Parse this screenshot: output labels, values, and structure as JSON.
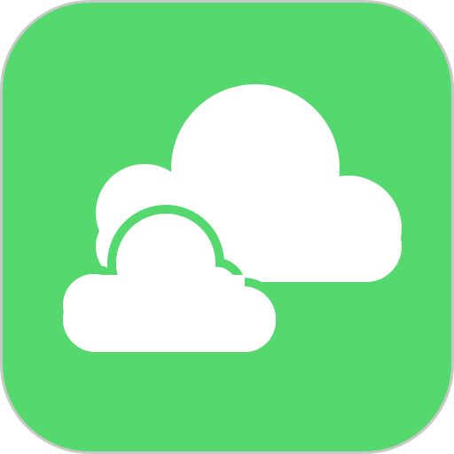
{
  "app_icon": {
    "icon": "cloud-icon",
    "background_color": "#55D96F",
    "border_color": "#C8C8C8",
    "cloud_color": "#FFFFFF"
  }
}
